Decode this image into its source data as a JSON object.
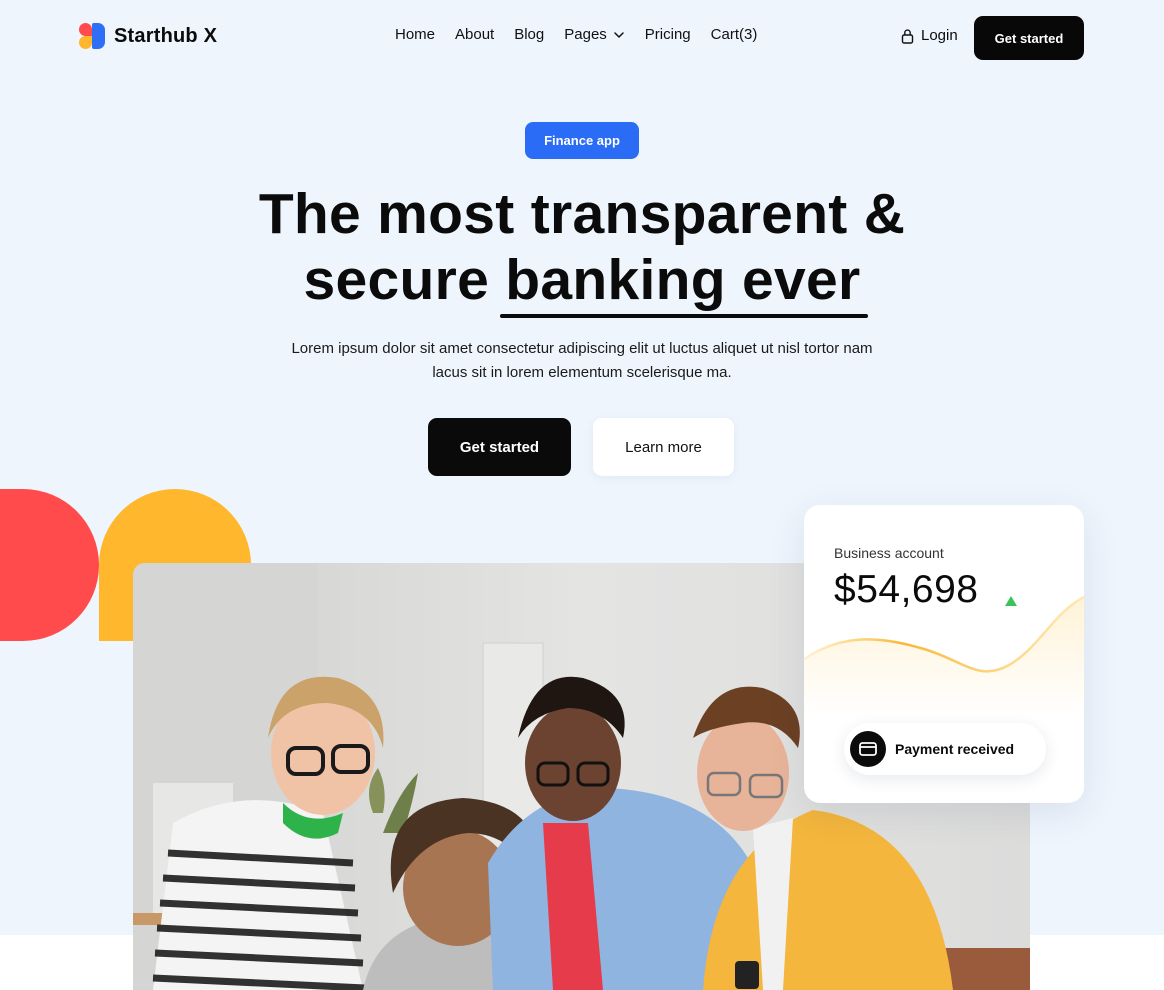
{
  "brand": {
    "name": "Starthub X"
  },
  "nav": {
    "items": [
      {
        "label": "Home"
      },
      {
        "label": "About"
      },
      {
        "label": "Blog"
      },
      {
        "label": "Pages",
        "has_dropdown": true
      },
      {
        "label": "Pricing"
      },
      {
        "label": "Cart(3)"
      }
    ],
    "login_label": "Login",
    "cta_label": "Get started"
  },
  "hero": {
    "badge": "Finance app",
    "title_line1": "The most transparent &",
    "title_line2_plain": "secure ",
    "title_line2_emphasis": "banking ever",
    "description": "Lorem ipsum dolor sit amet consectetur adipiscing elit ut luctus aliquet ut nisl tortor nam lacus sit in lorem elementum scelerisque ma.",
    "primary_button": "Get started",
    "secondary_button": "Learn more"
  },
  "account_card": {
    "label": "Business account",
    "amount": "$54,698",
    "trend": "up",
    "payment_label": "Payment received"
  },
  "colors": {
    "background": "#eef5fd",
    "accent_blue": "#2a6cf5",
    "brand_red": "#ff4b4b",
    "brand_yellow": "#ffb82e",
    "positive_green": "#3cc25a",
    "dark": "#0a0a0a"
  },
  "icons": {
    "logo": "starthub-logo-icon",
    "pages_dropdown": "chevron-down-icon",
    "login": "lock-icon",
    "trend": "trend-up-icon",
    "payment": "credit-card-icon"
  }
}
